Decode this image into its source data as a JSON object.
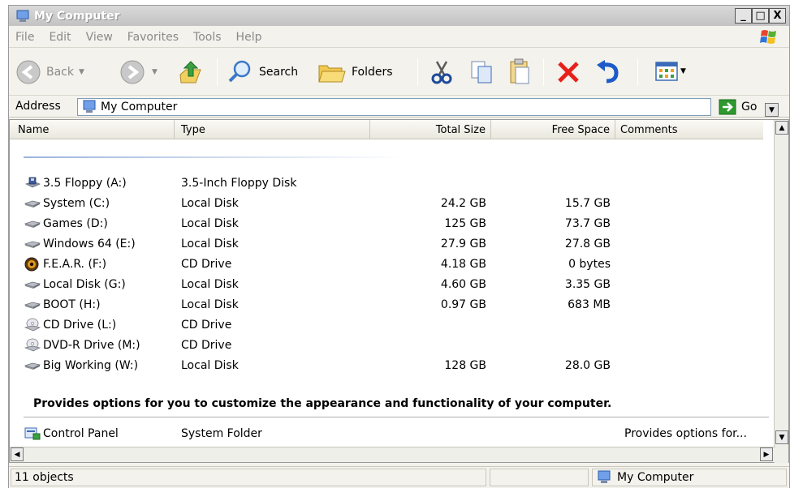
{
  "window": {
    "title": "My Computer",
    "minimize": "_",
    "maximize": "□",
    "close": "X"
  },
  "menu": [
    "File",
    "Edit",
    "View",
    "Favorites",
    "Tools",
    "Help"
  ],
  "toolbar": {
    "back": "Back",
    "search": "Search",
    "folders": "Folders"
  },
  "address": {
    "label": "Address",
    "value": "My Computer",
    "go": "Go"
  },
  "columns": {
    "name": "Name",
    "type": "Type",
    "total": "Total Size",
    "free": "Free Space",
    "comments": "Comments"
  },
  "drives": [
    {
      "name": "3.5 Floppy (A:)",
      "type": "3.5-Inch Floppy Disk",
      "total": "",
      "free": "",
      "icon": "floppy-icon"
    },
    {
      "name": "System (C:)",
      "type": "Local Disk",
      "total": "24.2 GB",
      "free": "15.7 GB",
      "icon": "hard-disk-icon"
    },
    {
      "name": "Games (D:)",
      "type": "Local Disk",
      "total": "125 GB",
      "free": "73.7 GB",
      "icon": "hard-disk-icon"
    },
    {
      "name": "Windows 64 (E:)",
      "type": "Local Disk",
      "total": "27.9 GB",
      "free": "27.8 GB",
      "icon": "hard-disk-icon"
    },
    {
      "name": "F.E.A.R. (F:)",
      "type": "CD Drive",
      "total": "4.18 GB",
      "free": "0 bytes",
      "icon": "game-disc-icon"
    },
    {
      "name": "Local Disk (G:)",
      "type": "Local Disk",
      "total": "4.60 GB",
      "free": "3.35 GB",
      "icon": "hard-disk-icon"
    },
    {
      "name": "BOOT (H:)",
      "type": "Local Disk",
      "total": "0.97 GB",
      "free": "683 MB",
      "icon": "hard-disk-icon"
    },
    {
      "name": "CD Drive (L:)",
      "type": "CD Drive",
      "total": "",
      "free": "",
      "icon": "cd-drive-icon"
    },
    {
      "name": "DVD-R Drive (M:)",
      "type": "CD Drive",
      "total": "",
      "free": "",
      "icon": "cd-drive-icon"
    },
    {
      "name": "Big Working (W:)",
      "type": "Local Disk",
      "total": "128 GB",
      "free": "28.0 GB",
      "icon": "hard-disk-icon"
    }
  ],
  "description": "Provides options for you to customize the appearance and functionality of your computer.",
  "control_panel": {
    "name": "Control Panel",
    "type": "System Folder",
    "comment": "Provides options for..."
  },
  "status": {
    "count": "11 objects",
    "location": "My Computer"
  },
  "colors": {
    "title_bar": "#c8c8c8",
    "window_bg": "#f3f2ec",
    "delete_red": "#e8201a",
    "go_green": "#2e9a2e"
  }
}
